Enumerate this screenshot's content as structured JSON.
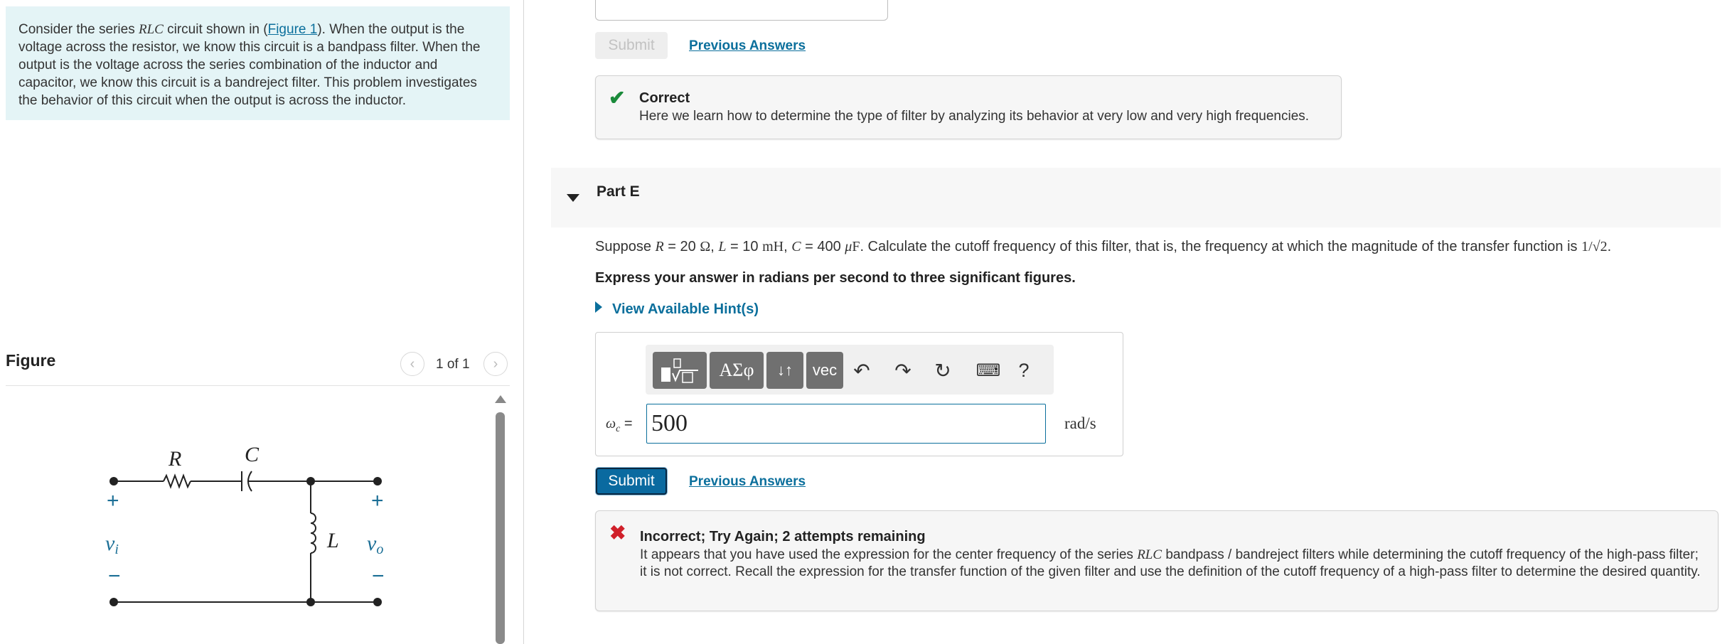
{
  "intro": {
    "before_circuit": "Consider the series ",
    "circuit_name": "RLC",
    "shown_in": " circuit shown in (",
    "figure_link": "Figure 1",
    "text": "). When the output is the voltage across the resistor, we know this circuit is a bandpass filter. When the output is the voltage across the series combination of the inductor and capacitor, we know this circuit is a bandreject filter. This problem investigates the behavior of this circuit when the output is across the inductor."
  },
  "figure": {
    "heading": "Figure",
    "counter": "1 of 1",
    "prev_icon": "chevron-left-icon",
    "next_icon": "chevron-right-icon",
    "labels": {
      "R": "R",
      "C": "C",
      "L": "L",
      "plus": "+",
      "minus": "−",
      "vi": "v",
      "vi_sub": "i",
      "vo": "v",
      "vo_sub": "o"
    }
  },
  "previous_part": {
    "submit_label": "Submit",
    "previous_answers_label": "Previous Answers",
    "feedback": {
      "icon": "check-icon",
      "title": "Correct",
      "body": "Here we learn how to determine the type of filter by analyzing its behavior at very low and very high frequencies."
    }
  },
  "part": {
    "title": "Part E",
    "question": {
      "suppose": "Suppose ",
      "r_sym": "R",
      "r_val": " = 20 ",
      "ohm": "Ω",
      "l_sym": "L",
      "l_val": " = 10 ",
      "mh": "mH",
      "c_sym": "C",
      "c_val": " = 400 ",
      "mu": "μ",
      "farad": "F",
      "rest": ". Calculate the cutoff frequency of this filter, that is, the frequency at which the magnitude of the transfer function is ",
      "value": "1/√2",
      "end": "."
    },
    "instruction": "Express your answer in radians per second to three significant figures.",
    "hint_label": "View Available Hint(s)",
    "toolbar": {
      "templates_icon": "templates-icon",
      "symbols_label": "ΑΣφ",
      "subsup_label": "↓↑",
      "vec_label": "vec",
      "undo_icon": "↶",
      "redo_icon": "↷",
      "reset_icon": "↻",
      "keyboard_icon": "⌨",
      "help_label": "?"
    },
    "answer": {
      "variable": "ω",
      "variable_sub": "c",
      "equals": " =",
      "value": "500",
      "unit": "rad/s"
    },
    "submit_label": "Submit",
    "previous_answers_label": "Previous Answers",
    "feedback": {
      "icon": "x-icon",
      "title": "Incorrect; Try Again; 2 attempts remaining",
      "body_before": "It appears that you have used the expression for the center frequency of the series ",
      "body_circuit": "RLC",
      "body_after": " bandpass / bandreject filters while determining the cutoff frequency of the high-pass filter; it is not correct. Recall the expression for the transfer function of the given filter and use the definition of the cutoff frequency of a high-pass filter to determine the desired quantity."
    }
  },
  "colors": {
    "intro_bg": "#e4f4f6",
    "link": "#0b6f9c",
    "correct": "#1a8a3a",
    "incorrect": "#d0202a",
    "submit_active": "#0a6aa0"
  }
}
